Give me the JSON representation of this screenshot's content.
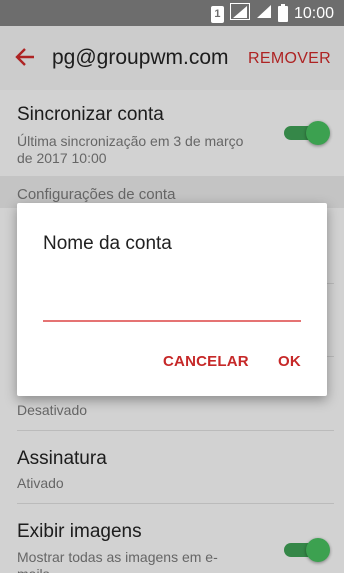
{
  "status_bar": {
    "sim_label": "1",
    "time": "10:00",
    "icons": [
      "sim-icon",
      "signal-icon",
      "signal-icon",
      "battery-icon"
    ]
  },
  "app_bar": {
    "back_icon": "arrow-left-icon",
    "title": "pg@groupwm.com",
    "action": "REMOVER",
    "accent_color": "#c62828"
  },
  "settings": {
    "sync": {
      "title": "Sincronizar conta",
      "subtitle_line1": "Última sincronização em 3 de março",
      "subtitle_line2": "de 2017  10:00",
      "toggle_on": true
    },
    "section_header": "Configurações de conta",
    "hidden_row_status": "Desativado",
    "signature": {
      "title": "Assinatura",
      "subtitle": "Ativado"
    },
    "show_images": {
      "title": "Exibir imagens",
      "subtitle_line1": "Mostrar todas as imagens em e-",
      "subtitle_line2": "mails",
      "toggle_on": true
    }
  },
  "dialog": {
    "title": "Nome da conta",
    "input_value": "",
    "cancel_label": "CANCELAR",
    "ok_label": "OK"
  }
}
